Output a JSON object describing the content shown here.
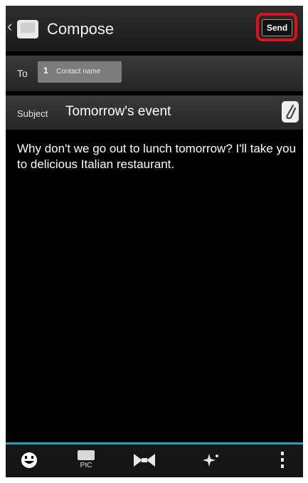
{
  "header": {
    "title": "Compose",
    "send_label": "Send"
  },
  "recipients": {
    "to_label": "To",
    "chip_label": "Contact name"
  },
  "subject": {
    "label": "Subject",
    "value": "Tomorrow's event"
  },
  "message": {
    "body": "Why don't we go out to lunch tomorrow? I'll take you to delicious Italian restaurant."
  },
  "toolbar": {
    "items": [
      "emoji-icon",
      "photo-pic-icon",
      "bow-tie-icon",
      "sparkle-icon",
      "overflow-menu-icon"
    ]
  },
  "colors": {
    "accent": "#19a2c9",
    "highlight": "#e0101b"
  }
}
